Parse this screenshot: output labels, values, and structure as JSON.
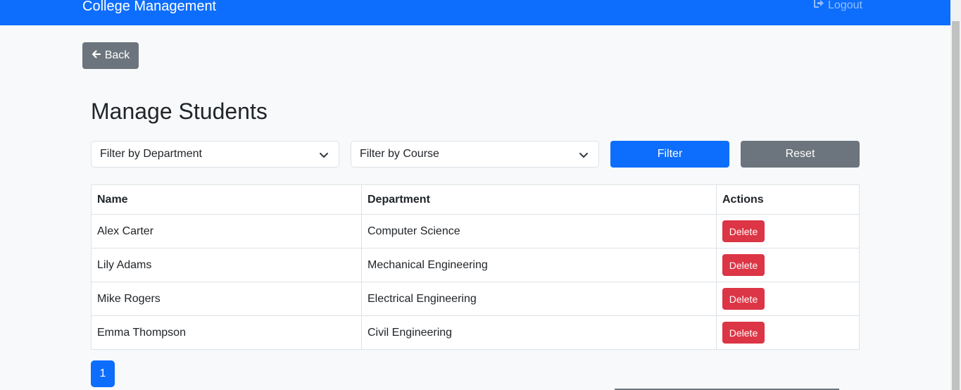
{
  "navbar": {
    "brand": "College Management",
    "logout_label": "Logout",
    "color": "#0d6efd"
  },
  "back_button": {
    "label": "Back"
  },
  "page_title": "Manage Students",
  "filters": {
    "department_placeholder": "Filter by Department",
    "course_placeholder": "Filter by Course",
    "filter_label": "Filter",
    "reset_label": "Reset"
  },
  "table": {
    "headers": [
      "Name",
      "Department",
      "Actions"
    ],
    "rows": [
      {
        "name": "Alex Carter",
        "department": "Computer Science",
        "action": "Delete"
      },
      {
        "name": "Lily Adams",
        "department": "Mechanical Engineering",
        "action": "Delete"
      },
      {
        "name": "Mike Rogers",
        "department": "Electrical Engineering",
        "action": "Delete"
      },
      {
        "name": "Emma Thompson",
        "department": "Civil Engineering",
        "action": "Delete"
      }
    ]
  },
  "pagination": {
    "current_page": "1"
  },
  "colors": {
    "primary": "#0d6efd",
    "secondary": "#6c757d",
    "danger": "#dc3545"
  }
}
